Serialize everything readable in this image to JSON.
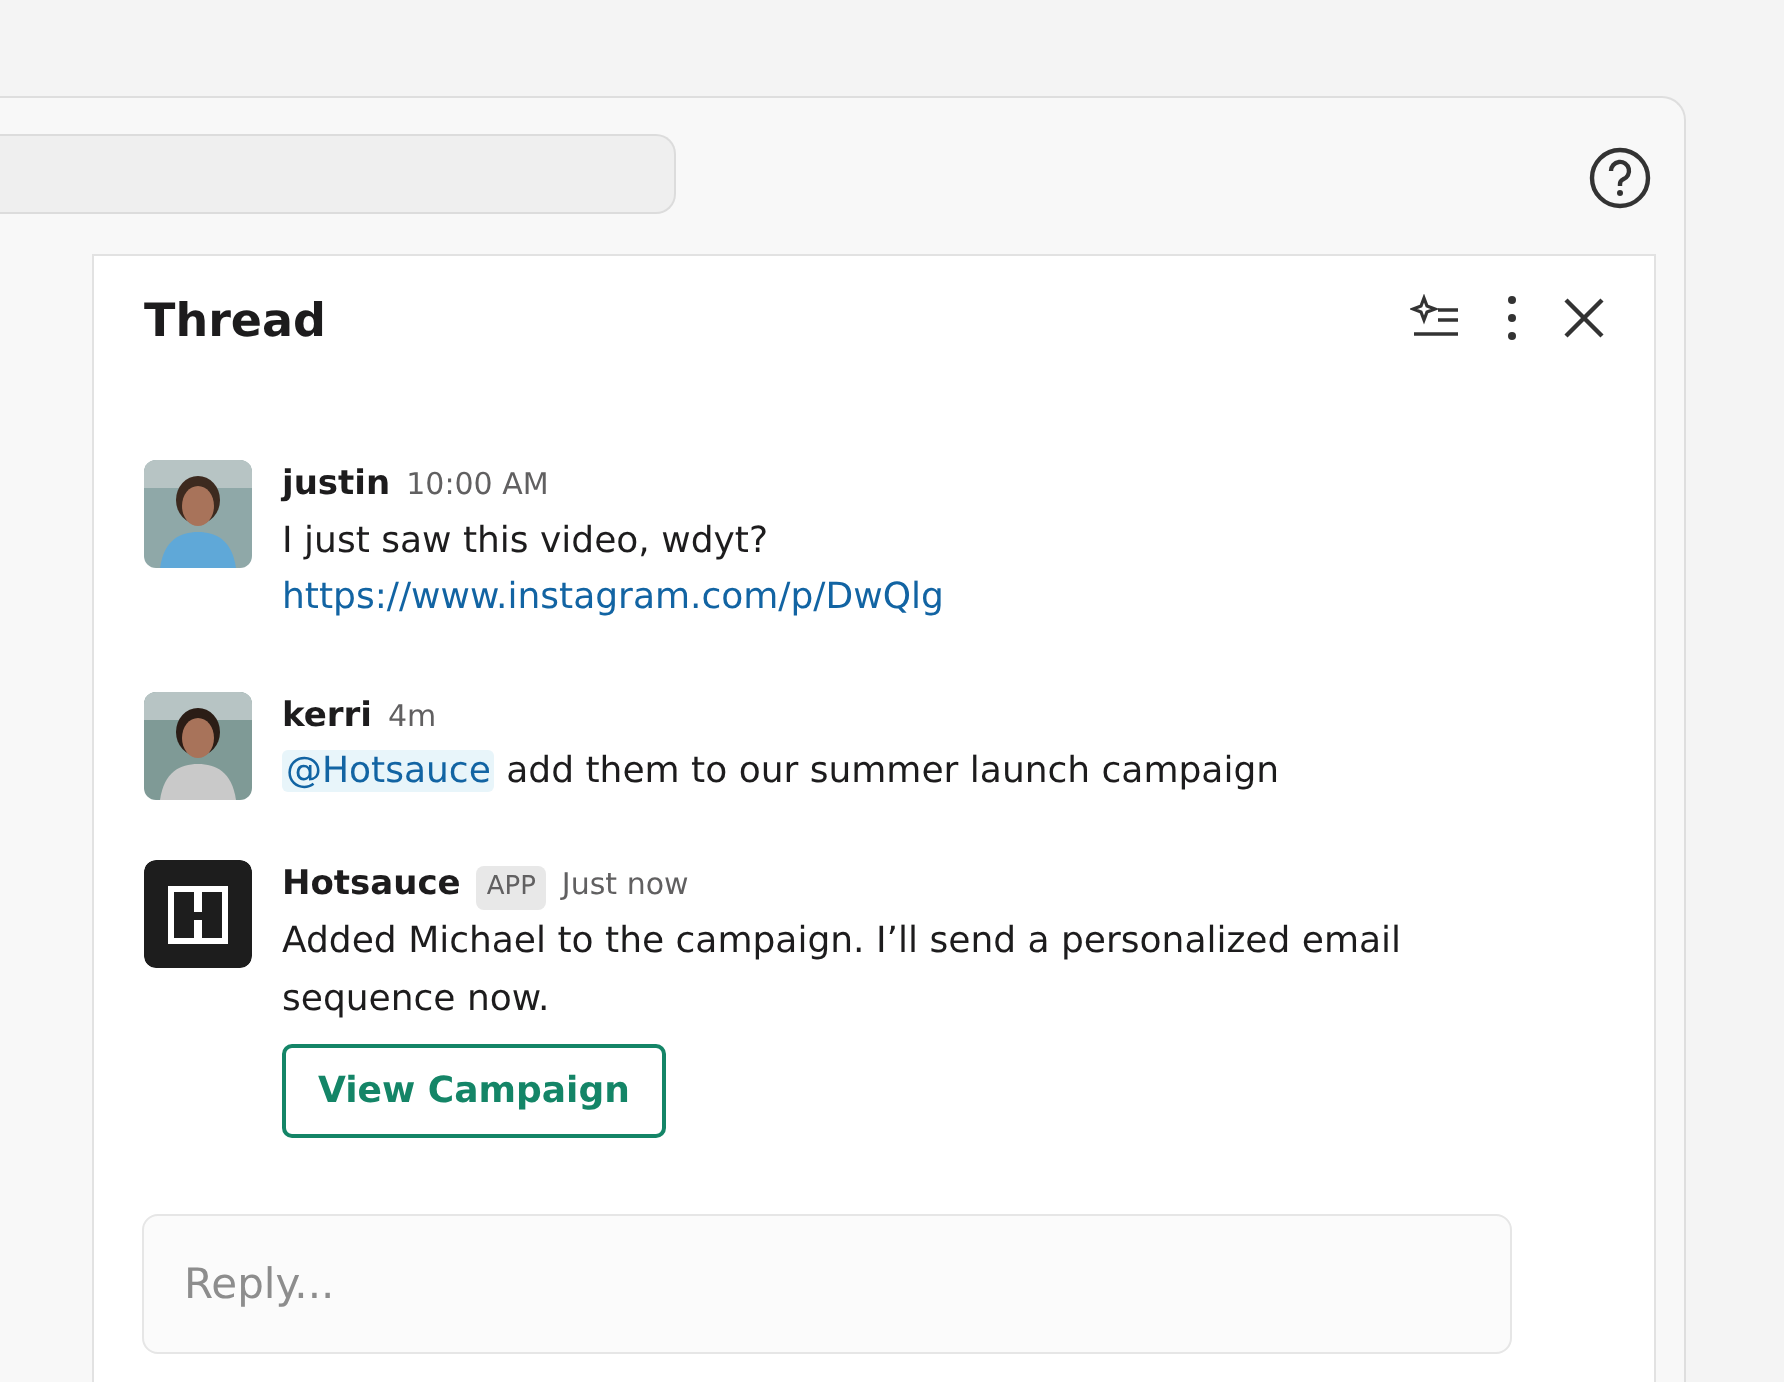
{
  "search": {
    "kind": "field"
  },
  "panel": {
    "title": "Thread"
  },
  "messages": [
    {
      "kind": "user",
      "author": "justin",
      "time": "10:00 AM",
      "text": "I just saw this video, wdyt?",
      "link": "https://www.instagram.com/p/DwQlg"
    },
    {
      "kind": "user",
      "author": "kerri",
      "time": "4m",
      "mention": "@Hotsauce",
      "text": "add them to our summer launch campaign"
    },
    {
      "kind": "app",
      "author": "Hotsauce",
      "badge": "APP",
      "time": "Just now",
      "text": "Added Michael to the campaign. I’ll send a personalized email sequence now.",
      "button": "View Campaign"
    }
  ],
  "reply": {
    "placeholder": "Reply..."
  }
}
